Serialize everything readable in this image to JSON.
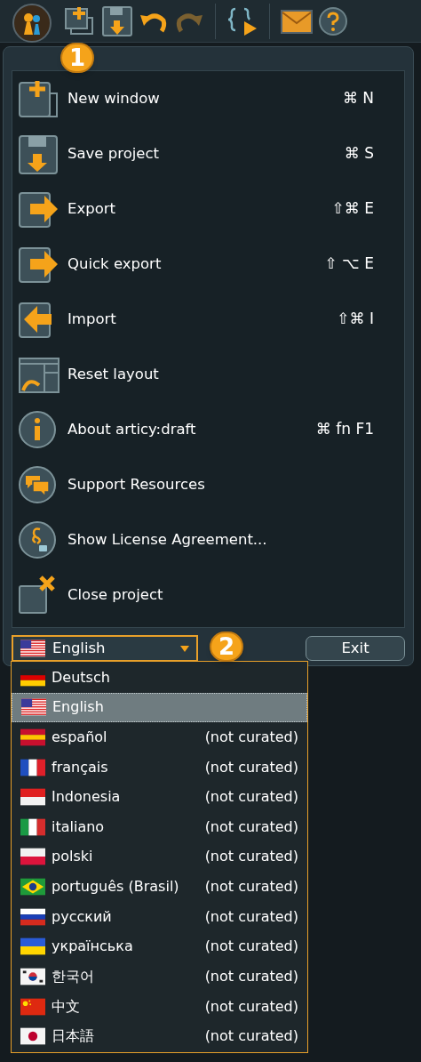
{
  "callouts": [
    "1",
    "2"
  ],
  "menu": {
    "items": [
      {
        "kind": "new",
        "label": "New window",
        "shortcut": "⌘ N"
      },
      {
        "kind": "save",
        "label": "Save project",
        "shortcut": "⌘ S"
      },
      {
        "kind": "export",
        "label": "Export",
        "shortcut": "⇧⌘ E"
      },
      {
        "kind": "export",
        "label": "Quick export",
        "shortcut": "⇧ ⌥ E"
      },
      {
        "kind": "import",
        "label": "Import",
        "shortcut": "⇧⌘ I"
      },
      {
        "kind": "layout",
        "label": "Reset layout"
      },
      {
        "kind": "info",
        "label": "About articy:draft",
        "shortcut": "⌘ fn F1"
      },
      {
        "kind": "support",
        "label": "Support Resources"
      },
      {
        "kind": "license",
        "label": "Show License Agreement..."
      },
      {
        "kind": "close",
        "label": "Close project"
      }
    ]
  },
  "language_select": {
    "kind": "us",
    "value": "English"
  },
  "exit_button": "Exit",
  "languages": [
    {
      "kind": "de",
      "label": "Deutsch",
      "selected": false
    },
    {
      "kind": "us",
      "label": "English",
      "selected": true
    },
    {
      "kind": "es",
      "label": "español",
      "note": "(not curated)",
      "selected": false
    },
    {
      "kind": "fr",
      "label": "français",
      "note": "(not curated)",
      "selected": false
    },
    {
      "kind": "id",
      "label": "Indonesia",
      "note": "(not curated)",
      "selected": false
    },
    {
      "kind": "it",
      "label": "italiano",
      "note": "(not curated)",
      "selected": false
    },
    {
      "kind": "pl",
      "label": "polski",
      "note": "(not curated)",
      "selected": false
    },
    {
      "kind": "br",
      "label": "português (Brasil)",
      "note": "(not curated)",
      "selected": false
    },
    {
      "kind": "ru",
      "label": "русский",
      "note": "(not curated)",
      "selected": false
    },
    {
      "kind": "ua",
      "label": "українська",
      "note": "(not curated)",
      "selected": false
    },
    {
      "kind": "kr",
      "label": "한국어",
      "note": "(not curated)",
      "selected": false
    },
    {
      "kind": "cn",
      "label": "中文",
      "note": "(not curated)",
      "selected": false
    },
    {
      "kind": "jp",
      "label": "日本語",
      "note": "(not curated)",
      "selected": false
    }
  ]
}
